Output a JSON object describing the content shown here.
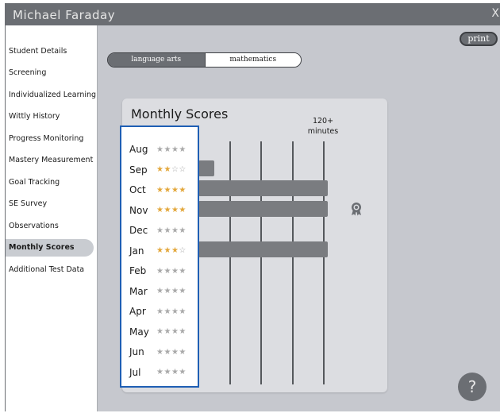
{
  "window": {
    "title": "Michael Faraday",
    "close_glyph": "X"
  },
  "sidebar": {
    "items": [
      {
        "label": "Student Details",
        "active": false
      },
      {
        "label": "Screening",
        "active": false
      },
      {
        "label": "Individualized Learning",
        "active": false
      },
      {
        "label": "Wittly History",
        "active": false
      },
      {
        "label": "Progress Monitoring",
        "active": false
      },
      {
        "label": "Mastery Measurement",
        "active": false
      },
      {
        "label": "Goal Tracking",
        "active": false
      },
      {
        "label": "SE Survey",
        "active": false
      },
      {
        "label": "Observations",
        "active": false
      },
      {
        "label": "Monthly Scores",
        "active": true
      },
      {
        "label": "Additional Test Data",
        "active": false
      }
    ]
  },
  "toolbar": {
    "print_label": "print"
  },
  "tabs": [
    {
      "label": "language arts",
      "selected": true
    },
    {
      "label": "mathematics",
      "selected": false
    }
  ],
  "card": {
    "title": "Monthly Scores",
    "minutes_label_line1": "120+",
    "minutes_label_line2": "minutes",
    "award_icon": "award-ribbon-icon"
  },
  "months": [
    {
      "name": "Aug",
      "stars": 0,
      "minutes_fraction": 0,
      "award": false
    },
    {
      "name": "Sep",
      "stars": 2,
      "minutes_fraction": 0.06,
      "award": false
    },
    {
      "name": "Oct",
      "stars": 4,
      "minutes_fraction": 1.0,
      "award": false
    },
    {
      "name": "Nov",
      "stars": 4,
      "minutes_fraction": 1.0,
      "award": true
    },
    {
      "name": "Dec",
      "stars": 0,
      "minutes_fraction": 0,
      "award": false
    },
    {
      "name": "Jan",
      "stars": 3,
      "minutes_fraction": 1.0,
      "award": false
    },
    {
      "name": "Feb",
      "stars": 0,
      "minutes_fraction": 0,
      "award": false
    },
    {
      "name": "Mar",
      "stars": 0,
      "minutes_fraction": 0,
      "award": false
    },
    {
      "name": "Apr",
      "stars": 0,
      "minutes_fraction": 0,
      "award": false
    },
    {
      "name": "May",
      "stars": 0,
      "minutes_fraction": 0,
      "award": false
    },
    {
      "name": "Jun",
      "stars": 0,
      "minutes_fraction": 0,
      "award": false
    },
    {
      "name": "Jul",
      "stars": 0,
      "minutes_fraction": 0,
      "award": false
    }
  ],
  "max_stars": 4,
  "help": {
    "label": "?"
  },
  "colors": {
    "star_on": "#e3a73b",
    "star_off": "#a9a9a9",
    "highlight_border": "#1f5fb4",
    "bar": "#7a7c80"
  }
}
